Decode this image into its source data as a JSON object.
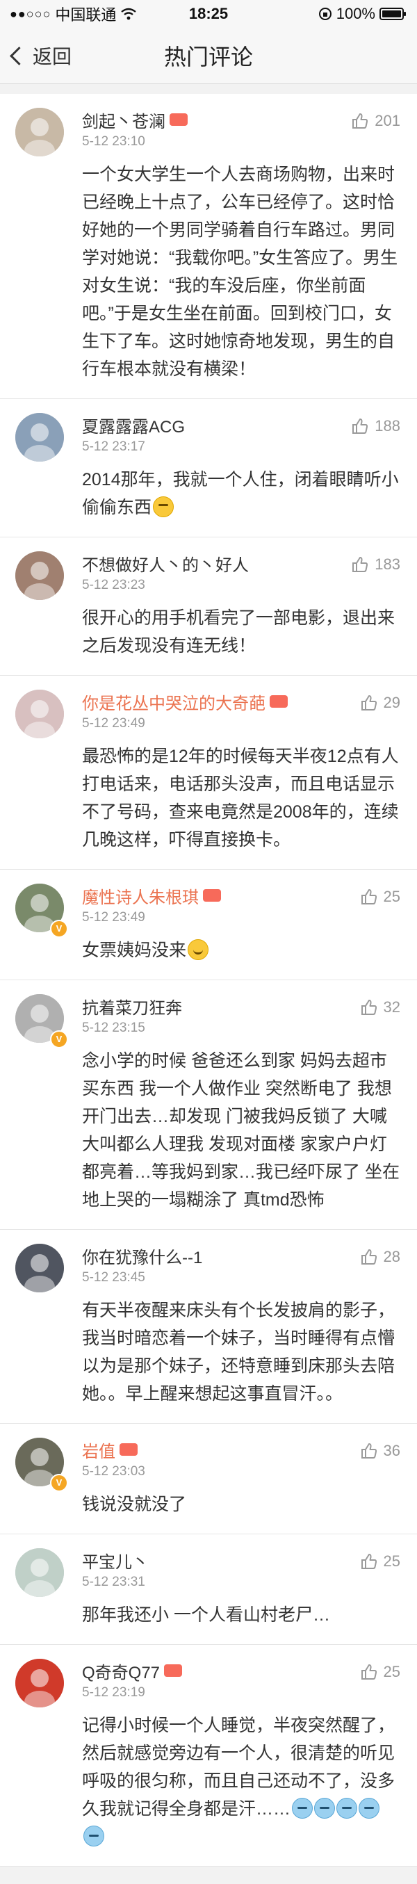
{
  "status_bar": {
    "signal": "●●○○○",
    "carrier": "中国联通",
    "wifi_icon": "wifi-icon",
    "time": "18:25",
    "battery": "100%"
  },
  "nav": {
    "back_label": "返回",
    "title": "热门评论"
  },
  "comments": [
    {
      "username": "剑起丶苍澜",
      "name_color": "default",
      "badge": true,
      "time": "5-12 23:10",
      "likes": "201",
      "text": "一个女大学生一个人去商场购物，出来时已经晚上十点了，公车已经停了。这时恰好她的一个男同学骑着自行车路过。男同学对她说：“我载你吧。”女生答应了。男生对女生说：“我的车没后座，你坐前面吧。”于是女生坐在前面。回到校门口，女生下了车。这时她惊奇地发现，男生的自行车根本就没有横梁！",
      "avatar_color": "#c8b9a6",
      "verified": false
    },
    {
      "username": "夏露露露ACG",
      "name_color": "default",
      "badge": false,
      "time": "5-12 23:17",
      "likes": "188",
      "text": "2014那年，我就一个人住，闭着眼睛听小偷偷东西",
      "emoji": "think",
      "avatar_color": "#8aa0b8",
      "verified": false
    },
    {
      "username": "不想做好人丶的丶好人",
      "name_color": "default",
      "badge": false,
      "time": "5-12 23:23",
      "likes": "183",
      "text": "很开心的用手机看完了一部电影，退出来之后发现没有连无线！",
      "avatar_color": "#a08070",
      "verified": false
    },
    {
      "username": "你是花丛中哭泣的大奇葩",
      "name_color": "orange",
      "badge": true,
      "time": "5-12 23:49",
      "likes": "29",
      "text": "最恐怖的是12年的时候每天半夜12点有人打电话来，电话那头没声，而且电话显示不了号码，查来电竟然是2008年的，连续几晚这样，吓得直接换卡。",
      "avatar_color": "#d8c0c0",
      "verified": false
    },
    {
      "username": "魔性诗人朱根琪",
      "name_color": "orange",
      "badge": true,
      "time": "5-12 23:49",
      "likes": "25",
      "text": "女票姨妈没来",
      "emoji": "smile",
      "avatar_color": "#7a8a6a",
      "verified": true
    },
    {
      "username": "抗着菜刀狂奔",
      "name_color": "default",
      "badge": false,
      "time": "5-12 23:15",
      "likes": "32",
      "text": "念小学的时候 爸爸还么到家 妈妈去超市买东西 我一个人做作业 突然断电了 我想开门出去…却发现 门被我妈反锁了 大喊大叫都么人理我 发现对面楼 家家户户灯都亮着…等我妈到家…我已经吓尿了 坐在地上哭的一塌糊涂了 真tmd恐怖",
      "avatar_color": "#b0b0b0",
      "verified": true
    },
    {
      "username": "你在犹豫什么--1",
      "name_color": "default",
      "badge": false,
      "time": "5-12 23:45",
      "likes": "28",
      "text": "有天半夜醒来床头有个长发披肩的影子，我当时暗恋着一个妹子，当时睡得有点懵以为是那个妹子，还特意睡到床那头去陪她。。早上醒来想起这事直冒汗。。",
      "avatar_color": "#505560",
      "verified": false
    },
    {
      "username": "岩值",
      "name_color": "orange",
      "badge": true,
      "time": "5-12 23:03",
      "likes": "36",
      "text": "钱说没就没了",
      "avatar_color": "#6a6a5a",
      "verified": true
    },
    {
      "username": "平宝儿丶",
      "name_color": "default",
      "badge": false,
      "time": "5-12 23:31",
      "likes": "25",
      "text": "那年我还小 一个人看山村老尸…",
      "avatar_color": "#c0d0c8",
      "verified": false
    },
    {
      "username": "Q奇奇Q77",
      "name_color": "default",
      "badge": true,
      "time": "5-12 23:19",
      "likes": "25",
      "text": "记得小时候一个人睡觉，半夜突然醒了，然后就感觉旁边有一个人，很清楚的听见呼吸的很匀称，而且自己还动不了，没多久我就记得全身都是汗……",
      "emoji": "sweat",
      "emoji_count": 5,
      "avatar_color": "#d03a2a",
      "verified": false
    }
  ]
}
